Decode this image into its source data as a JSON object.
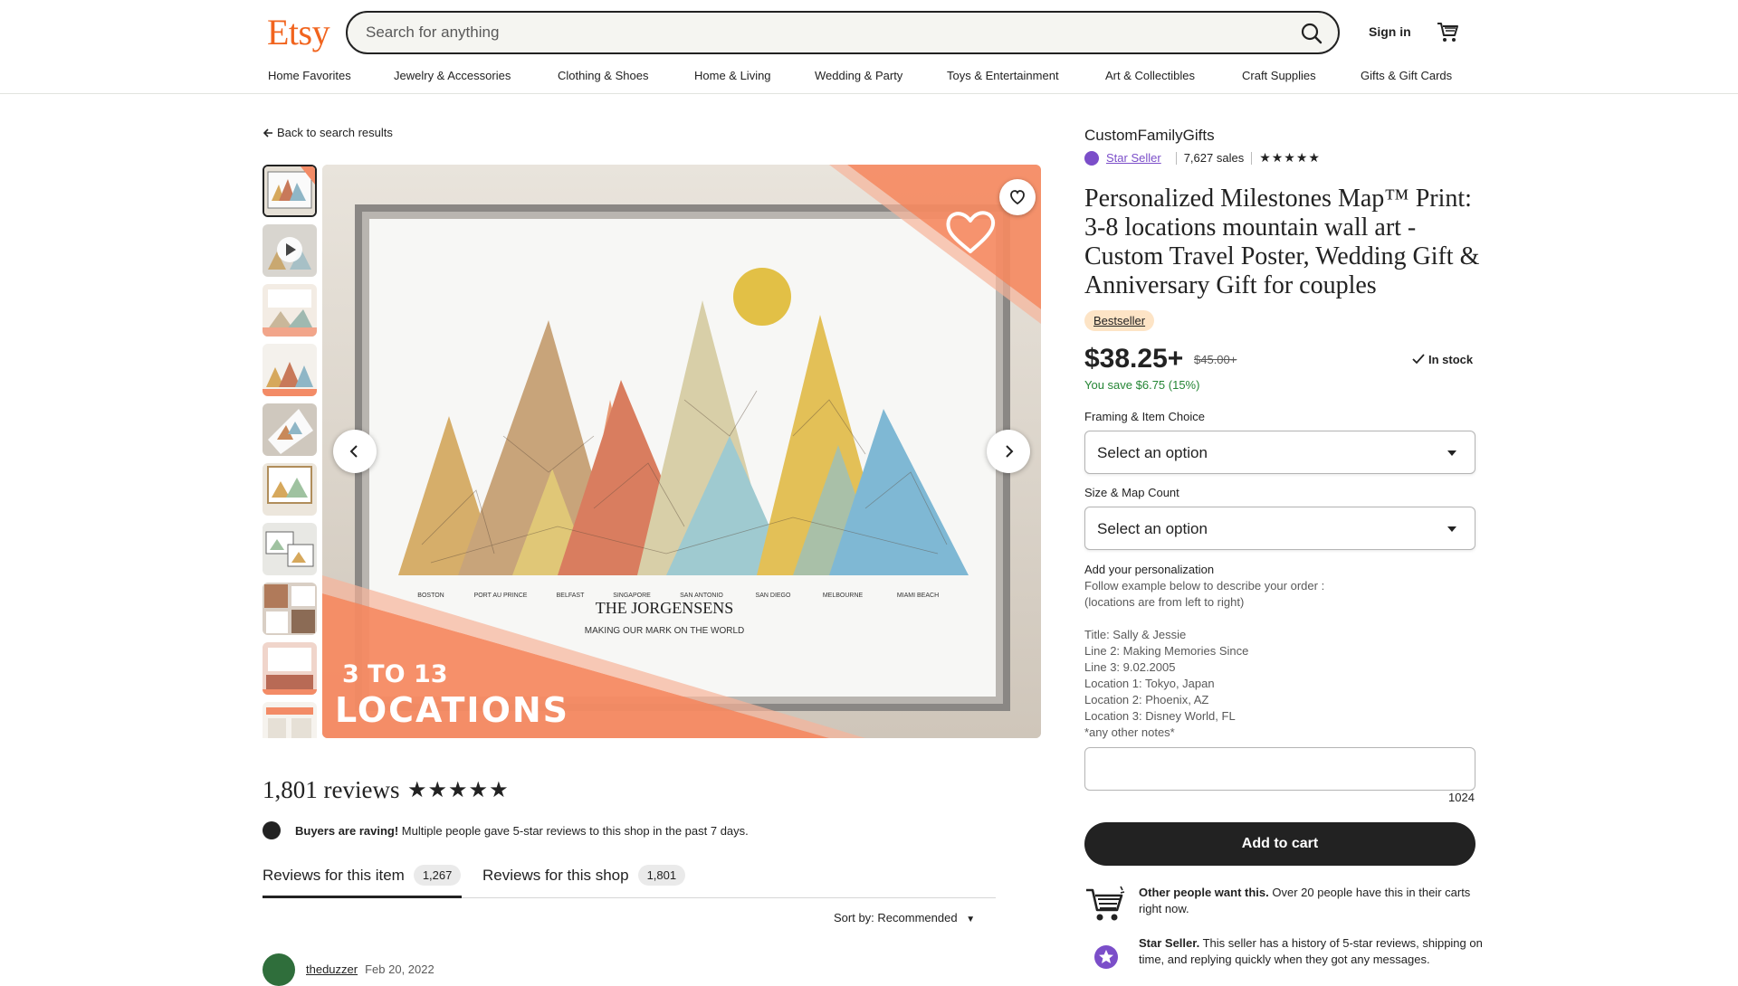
{
  "header": {
    "logo": "Etsy",
    "search_placeholder": "Search for anything",
    "sign_in": "Sign in",
    "nav": [
      "Home Favorites",
      "Jewelry & Accessories",
      "Clothing & Shoes",
      "Home & Living",
      "Wedding & Party",
      "Toys & Entertainment",
      "Art & Collectibles",
      "Craft Supplies",
      "Gifts & Gift Cards"
    ]
  },
  "listing": {
    "back_link": "Back to search results",
    "image_overlay_top": "",
    "image_overlay_count": "3 TO 13",
    "image_overlay_word": "LOCATIONS",
    "image_family_name": "THE JORGENSENS",
    "image_tagline": "MAKING OUR MARK ON THE WORLD",
    "image_locations": [
      "BOSTON",
      "PORT AU PRINCE",
      "BELFAST",
      "SINGAPORE",
      "SAN ANTONIO",
      "SAN DIEGO",
      "MELBOURNE",
      "MIAMI BEACH"
    ]
  },
  "reviews": {
    "title": "1,801 reviews",
    "stars": "★★★★★",
    "raving_bold": "Buyers are raving!",
    "raving_text": " Multiple people gave 5-star reviews to this shop in the past 7 days.",
    "tab_item_label": "Reviews for this item",
    "tab_item_count": "1,267",
    "tab_shop_label": "Reviews for this shop",
    "tab_shop_count": "1,801",
    "sort_label": "Sort by: Recommended",
    "first_reviewer": "theduzzer",
    "first_date": "Feb 20, 2022"
  },
  "product": {
    "shop_name": "CustomFamilyGifts",
    "star_seller": "Star Seller",
    "sales": "7,627 sales",
    "shop_stars": "★★★★★",
    "title": "Personalized Milestones Map™ Print: 3-8 locations mountain wall art - Custom Travel Poster, Wedding Gift & Anniversary Gift for couples",
    "badge": "Bestseller",
    "price": "$38.25+",
    "old_price": "$45.00+",
    "stock": "In stock",
    "save": "You save $6.75 (15%)",
    "option1_label": "Framing & Item Choice",
    "option1_value": "Select an option",
    "option2_label": "Size & Map Count",
    "option2_value": "Select an option",
    "personalization_label": "Add your personalization",
    "personalization_instructions": "Follow example below to describe your order   :\n(locations are from left to right)\n\nTitle: Sally & Jessie\nLine 2: Making Memories Since\nLine 3: 9.02.2005\nLocation 1: Tokyo, Japan\nLocation 2: Phoenix, AZ\nLocation 3: Disney World, FL\n*any other notes*",
    "char_counter": "1024",
    "add_to_cart": "Add to cart",
    "info1_bold": "Other people want this.",
    "info1_text": " Over 20 people have this in their carts right now.",
    "info2_bold": "Star Seller.",
    "info2_text": " This seller has a history of 5-star reviews, shipping on time, and replying quickly when they got any messages."
  },
  "colors": {
    "brand": "#f1641e",
    "star_seller": "#7b4ec9",
    "save_green": "#258635",
    "badge_bg": "#fde4c6"
  }
}
